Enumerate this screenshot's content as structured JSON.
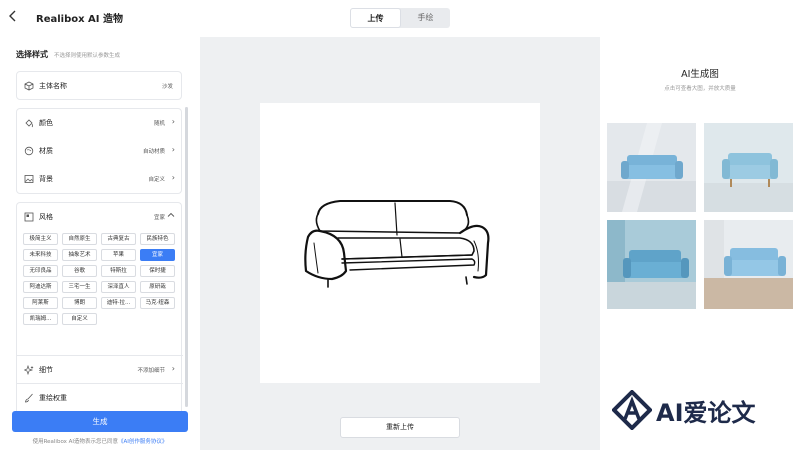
{
  "header": {
    "title": "Realibox AI 造物",
    "tabs": [
      {
        "label": "上传",
        "active": true
      },
      {
        "label": "手绘",
        "active": false
      }
    ]
  },
  "left": {
    "section_title": "选择样式",
    "section_hint": "不选择则使用默认参数生成",
    "subject": {
      "label": "主体名称",
      "value": "沙发"
    },
    "color": {
      "label": "颜色",
      "value": "随机"
    },
    "material": {
      "label": "材质",
      "value": "自动材质"
    },
    "background": {
      "label": "背景",
      "value": "自定义"
    },
    "style": {
      "label": "风格",
      "value": "宜家",
      "tags": [
        "极简主义",
        "自然原生",
        "古典复古",
        "民族特色",
        "未来科技",
        "抽象艺术",
        "苹果",
        "宜家",
        "无印良品",
        "谷歌",
        "特斯拉",
        "保时捷",
        "阿迪达斯",
        "三宅一生",
        "深泽直人",
        "原研哉",
        "阿莱斯",
        "博朗",
        "迪特·拉...",
        "马克·纽森",
        "凯瑞姆...",
        "自定义"
      ],
      "selected": "宜家"
    },
    "detail": {
      "label": "细节",
      "value": "不添加细节"
    },
    "weight": {
      "label": "重绘权重"
    },
    "generate_label": "生成",
    "terms_prefix": "使用Realibox AI造物表示您已同意",
    "terms_link": "《AI创作服务协议》"
  },
  "center": {
    "reupload_label": "重新上传"
  },
  "right": {
    "title": "AI生成图",
    "hint": "点击可查看大图，并放大质量"
  },
  "watermark": "AI爱论文",
  "colors": {
    "accent": "#3b7df5",
    "sofa_blue": "#7fb6d9",
    "center_bg": "#eef0f2"
  },
  "icons": {
    "back": "chevron-left-icon",
    "subject": "cube-icon",
    "color": "paint-bucket-icon",
    "material": "material-circle-icon",
    "background": "image-icon",
    "style": "style-grid-icon",
    "detail": "sparkle-icon",
    "weight": "brush-icon"
  }
}
